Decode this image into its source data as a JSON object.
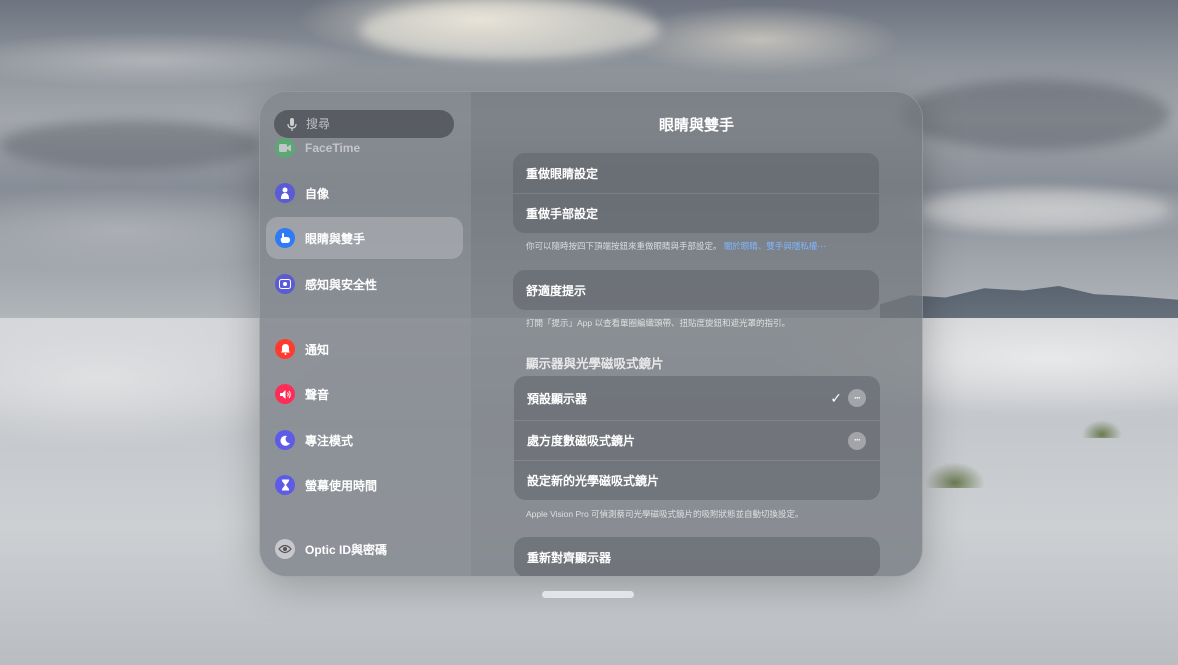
{
  "search": {
    "placeholder": "搜尋"
  },
  "sidebar": {
    "items": [
      {
        "label": "FaceTime",
        "icon": "facetime-icon",
        "color": "#34c759"
      },
      {
        "label": "自像",
        "icon": "persona-icon",
        "color": "#5b5bd6"
      },
      {
        "label": "眼睛與雙手",
        "icon": "hand-icon",
        "color": "#2f7bf5"
      },
      {
        "label": "感知與安全性",
        "icon": "awareness-icon",
        "color": "#5b5bd6"
      },
      {
        "label": "通知",
        "icon": "bell-icon",
        "color": "#ff3b30"
      },
      {
        "label": "聲音",
        "icon": "speaker-icon",
        "color": "#ff2d55"
      },
      {
        "label": "專注模式",
        "icon": "moon-icon",
        "color": "#5e5ce6"
      },
      {
        "label": "螢幕使用時間",
        "icon": "hourglass-icon",
        "color": "#5e5ce6"
      },
      {
        "label": "Optic ID與密碼",
        "icon": "optic-id-icon",
        "color": "#8e8e93"
      }
    ]
  },
  "main": {
    "title": "眼睛與雙手",
    "setup_group": {
      "rows": [
        "重做眼睛設定",
        "重做手部設定"
      ],
      "note": "你可以隨時按四下頂端按鈕來重做眼睛與手部設定。",
      "note_link": "關於眼睛、雙手與隱私權⋯"
    },
    "comfort_group": {
      "row": "舒適度提示",
      "note": "打開「提示」App 以查看單圈編織頭帶、扭貼度旋鈕和遮光罩的指引。"
    },
    "display_section": {
      "header": "顯示器與光學磁吸式鏡片",
      "rows": [
        "預設顯示器",
        "處方度數磁吸式鏡片",
        "設定新的光學磁吸式鏡片"
      ],
      "checkmark": "✓",
      "more": "···",
      "note": "Apple Vision Pro 可偵測蔡司光學磁吸式鏡片的吸附狀態並自動切換設定。"
    },
    "realign_row": "重新對齊顯示器"
  }
}
